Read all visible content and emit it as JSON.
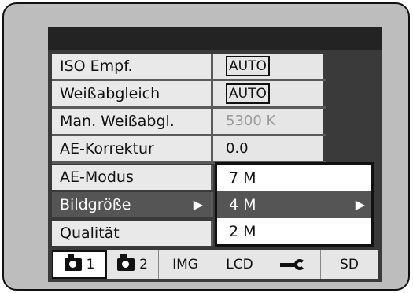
{
  "menu": {
    "rows": [
      {
        "label": "ISO Empf.",
        "value": "AUTO",
        "boxed": true,
        "dim": false
      },
      {
        "label": "Weißabgleich",
        "value": "AUTO",
        "boxed": true,
        "dim": false
      },
      {
        "label": "Man. Weißabgl.",
        "value": "5300 K",
        "boxed": false,
        "dim": true
      },
      {
        "label": "AE-Korrektur",
        "value": "0.0",
        "boxed": false,
        "dim": false
      },
      {
        "label": "AE-Modus"
      },
      {
        "label": "Bildgröße",
        "arrow": "▶"
      },
      {
        "label": "Qualität"
      }
    ]
  },
  "dropdown": {
    "options": [
      {
        "label": "7 M"
      },
      {
        "label": "4 M",
        "arrow": "▶"
      },
      {
        "label": "2 M"
      }
    ],
    "selected": "4 M"
  },
  "tabs": [
    {
      "label": "1",
      "icon": "camera-icon"
    },
    {
      "label": "2",
      "icon": "camera-icon"
    },
    {
      "label": "IMG"
    },
    {
      "label": "LCD"
    },
    {
      "label": "",
      "icon": "wrench-icon"
    },
    {
      "label": "SD"
    }
  ],
  "colors": {
    "highlight": "#555555",
    "panel": "#e6e6e6",
    "screen": "#3a3a3a"
  }
}
